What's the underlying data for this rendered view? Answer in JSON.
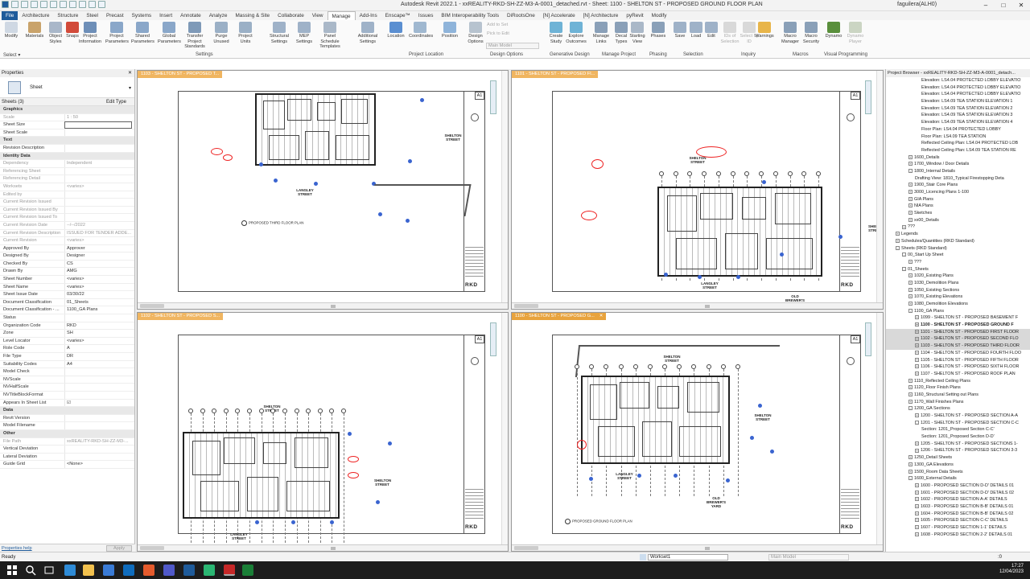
{
  "titlebar": {
    "title": "Autodesk Revit 2022.1 - xxREALITY-RKD-SH-ZZ-M3-A-0001_detached.rvt - Sheet: 1100 - SHELTON ST - PROPOSED GROUND FLOOR PLAN",
    "user": "faguilera(ALH0)"
  },
  "tabs": [
    "File",
    "Architecture",
    "Structure",
    "Steel",
    "Precast",
    "Systems",
    "Insert",
    "Annotate",
    "Analyze",
    "Massing & Site",
    "Collaborate",
    "View",
    "Manage",
    "Add-Ins",
    "Enscape™",
    "Issues",
    "BIM Interoperability Tools",
    "DiRootsOne",
    "[N] Accelerate",
    "[N] Architecture",
    "pyRevit",
    "Modify"
  ],
  "active_tab": "Manage",
  "ribbon": {
    "buttons": [
      "Modify",
      "Materials",
      "Object Styles",
      "Snaps",
      "Project Information",
      "Project Parameters",
      "Shared Parameters",
      "Global Parameters",
      "Transfer Project Standards",
      "Purge Unused",
      "Project Units",
      "Structural Settings",
      "MEP Settings",
      "Panel Schedule Templates",
      "Additional Settings",
      "Location",
      "Coordinates",
      "Position",
      "Design Options",
      "Create Study",
      "Explore Outcomes",
      "Manage Links",
      "Decal Types",
      "Starting View",
      "Phases",
      "Save",
      "Load",
      "Edit",
      "IDs of Selection",
      "Select by ID",
      "Warnings",
      "Macro Manager",
      "Macro Security",
      "Dynamo",
      "Dynamo Player"
    ],
    "small": [
      "Add to Set",
      "Pick to Edit"
    ],
    "design_option_value": "Main Model",
    "panels": [
      "Select ▾",
      "Settings",
      "Project Location",
      "Design Options",
      "Generative Design",
      "Manage Project",
      "Phasing",
      "Selection",
      "Inquiry",
      "Macros",
      "Visual Programming"
    ]
  },
  "properties": {
    "header": "Properties",
    "type_name": "Sheet",
    "filter": "Sheets (3)",
    "edit_type": "Edit Type",
    "rows": [
      {
        "g": "Graphics"
      },
      {
        "k": "Scale",
        "v": "1 : 50",
        "dis": true
      },
      {
        "k": "Sheet Size",
        "v": ""
      },
      {
        "k": "Sheet Scale",
        "v": ""
      },
      {
        "g": "Text"
      },
      {
        "k": "Revision Description",
        "v": ""
      },
      {
        "g": "Identity Data"
      },
      {
        "k": "Dependency",
        "v": "Independent",
        "dis": true
      },
      {
        "k": "Referencing Sheet",
        "v": "",
        "dis": true
      },
      {
        "k": "Referencing Detail",
        "v": "",
        "dis": true
      },
      {
        "k": "Worksets",
        "v": "<varies>",
        "dis": true
      },
      {
        "k": "Edited by",
        "v": "",
        "dis": true
      },
      {
        "k": "Current Revision Issued",
        "v": "",
        "dis": true
      },
      {
        "k": "Current Revision Issued By",
        "v": "",
        "dis": true
      },
      {
        "k": "Current Revision Issued To",
        "v": "",
        "dis": true
      },
      {
        "k": "Current Revision Date",
        "v": "--/--/2022",
        "dis": true
      },
      {
        "k": "Current Revision Description",
        "v": "ISSUED FOR TENDER ADDE...",
        "dis": true
      },
      {
        "k": "Current Revision",
        "v": "<varies>",
        "dis": true
      },
      {
        "k": "Approved By",
        "v": "Approver"
      },
      {
        "k": "Designed By",
        "v": "Designer"
      },
      {
        "k": "Checked By",
        "v": "CS"
      },
      {
        "k": "Drawn By",
        "v": "AMG"
      },
      {
        "k": "Sheet Number",
        "v": "<varies>"
      },
      {
        "k": "Sheet Name",
        "v": "<varies>"
      },
      {
        "k": "Sheet Issue Date",
        "v": "03/30/22"
      },
      {
        "k": "Document Classification",
        "v": "01_Sheets"
      },
      {
        "k": "Document Classification - ...",
        "v": "1100_GA Plans"
      },
      {
        "k": "Status",
        "v": ""
      },
      {
        "k": "Organization Code",
        "v": "RKD"
      },
      {
        "k": "Zone",
        "v": "SH"
      },
      {
        "k": "Level Locator",
        "v": "<varies>"
      },
      {
        "k": "Role Code",
        "v": "A"
      },
      {
        "k": "File Type",
        "v": "DR"
      },
      {
        "k": "Suitability Codes",
        "v": "A4"
      },
      {
        "k": "Model Check",
        "v": ""
      },
      {
        "k": "NVScale",
        "v": ""
      },
      {
        "k": "NVHalfScale",
        "v": ""
      },
      {
        "k": "NVTitleBlockFormat",
        "v": ""
      },
      {
        "k": "Appears In Sheet List",
        "v": "☑"
      },
      {
        "g": "Data"
      },
      {
        "k": "Revit Version",
        "v": ""
      },
      {
        "k": "Model Filename",
        "v": ""
      },
      {
        "g": "Other"
      },
      {
        "k": "File Path",
        "v": "xxREALITY-RKD-SH-ZZ-M3-...",
        "dis": true
      },
      {
        "k": "Vertical Deviation",
        "v": ""
      },
      {
        "k": "Lateral Deviation",
        "v": ""
      },
      {
        "k": "Guide Grid",
        "v": "<None>"
      }
    ],
    "help_link": "Properties help",
    "apply": "Apply"
  },
  "views": [
    {
      "tab": "1103 - SHELTON ST - PROPOSED T...",
      "active": false,
      "street": "LANGLEY STREET",
      "street2": "SHELTON STREET",
      "plan_title": "PROPOSED THIRD FLOOR PLAN"
    },
    {
      "tab": "1101 - SHELTON ST - PROPOSED FI...",
      "active": false,
      "street": "SHELTON STREET",
      "street2": "LANGLEY STREET",
      "street3": "OLD BREWER'S YARD",
      "plan_title": ""
    },
    {
      "tab": "1102 - SHELTON ST - PROPOSED S...",
      "active": false,
      "street": "SHELTON STREET",
      "street2": "LANGLEY STREET",
      "plan_title": ""
    },
    {
      "tab": "1100 - SHELTON ST - PROPOSED G...",
      "active": true,
      "street": "SHELTON STREET",
      "street2": "LANGLEY STREET",
      "street3": "OLD BREWER'S YARD",
      "plan_title": "PROPOSED GROUND FLOOR PLAN"
    }
  ],
  "sheet_labels": {
    "size": "A1",
    "logo": "RKD",
    "side_street": "SHELTON STREET"
  },
  "browser": {
    "header": "Project Browser - xxREALITY-RKD-SH-ZZ-M3-A-0001_detach...",
    "rows": [
      {
        "t": "Elevation: LS4.04 PROTECTED LOBBY ELEVATIO",
        "i": 5
      },
      {
        "t": "Elevation: LS4.04 PROTECTED LOBBY ELEVATIO",
        "i": 5
      },
      {
        "t": "Elevation: LS4.04 PROTECTED LOBBY ELEVATIO",
        "i": 5
      },
      {
        "t": "Elevation: LS4.09 TEA STATION ELEVATION 1",
        "i": 5
      },
      {
        "t": "Elevation: LS4.09 TEA STATION ELEVATION 2",
        "i": 5
      },
      {
        "t": "Elevation: LS4.09 TEA STATION ELEVATION 3",
        "i": 5
      },
      {
        "t": "Elevation: LS4.09 TEA STATION ELEVATION 4",
        "i": 5
      },
      {
        "t": "Floor Plan: LS4.04 PROTECTED LOBBY",
        "i": 5
      },
      {
        "t": "Floor Plan: LS4.09 TEA STATION",
        "i": 5
      },
      {
        "t": "Reflected Ceiling Plan: LS4.04 PROTECTED LOB",
        "i": 5
      },
      {
        "t": "Reflected Ceiling Plan: LS4.09 TEA STATION RE",
        "i": 5
      },
      {
        "t": "1600_Details",
        "i": 3,
        "tg": "+"
      },
      {
        "t": "1700_Window / Door Details",
        "i": 3,
        "tg": "+"
      },
      {
        "t": "1800_Internal Details",
        "i": 3,
        "tg": "-"
      },
      {
        "t": "Drafting View: 1810_Typical Firestopping Deta",
        "i": 4
      },
      {
        "t": "1900_Stair Core Plans",
        "i": 3,
        "tg": "+"
      },
      {
        "t": "3000_Licencing Plans 1-100",
        "i": 3,
        "tg": "+"
      },
      {
        "t": "GIA Plans",
        "i": 3,
        "tg": "+"
      },
      {
        "t": "NIA Plans",
        "i": 3,
        "tg": "+"
      },
      {
        "t": "Sketches",
        "i": 3,
        "tg": "+"
      },
      {
        "t": "xx00_Details",
        "i": 3,
        "tg": "+"
      },
      {
        "t": "???",
        "i": 2,
        "tg": "+"
      },
      {
        "t": "Legends",
        "i": 1,
        "tg": "+"
      },
      {
        "t": "Schedules/Quantities (RKD Standard)",
        "i": 1,
        "tg": "+"
      },
      {
        "t": "Sheets (RKD Standard)",
        "i": 1,
        "tg": "-"
      },
      {
        "t": "00_Start Up Sheet",
        "i": 2,
        "tg": "-"
      },
      {
        "t": "???",
        "i": 3,
        "tg": "+"
      },
      {
        "t": "01_Sheets",
        "i": 2,
        "tg": "-"
      },
      {
        "t": "1020_Existing Plans",
        "i": 3,
        "tg": "+"
      },
      {
        "t": "1030_Demolition Plans",
        "i": 3,
        "tg": "+"
      },
      {
        "t": "1050_Existing Sections",
        "i": 3,
        "tg": "+"
      },
      {
        "t": "1070_Existing Elevations",
        "i": 3,
        "tg": "+"
      },
      {
        "t": "1080_Demolition Elevations",
        "i": 3,
        "tg": "+"
      },
      {
        "t": "1100_GA Plans",
        "i": 3,
        "tg": "-"
      },
      {
        "t": "1099 - SHELTON ST - PROPOSED BASEMENT F",
        "i": 4,
        "tg": "+"
      },
      {
        "t": "1100 - SHELTON ST - PROPOSED GROUND F",
        "i": 4,
        "tg": "+",
        "bold": true
      },
      {
        "t": "1101 - SHELTON ST - PROPOSED FIRST FLOOR",
        "i": 4,
        "tg": "+",
        "sel": true
      },
      {
        "t": "1102 - SHELTON ST - PROPOSED SECOND FLO",
        "i": 4,
        "tg": "+",
        "sel": true
      },
      {
        "t": "1103 - SHELTON ST - PROPOSED THIRD FLOOR",
        "i": 4,
        "tg": "+",
        "sel": true
      },
      {
        "t": "1104 - SHELTON ST - PROPOSED FOURTH FLOO",
        "i": 4,
        "tg": "+"
      },
      {
        "t": "1105 - SHELTON ST - PROPOSED FIFTH FLOOR",
        "i": 4,
        "tg": "+"
      },
      {
        "t": "1106 - SHELTON ST - PROPOSED SIXTH FLOOR",
        "i": 4,
        "tg": "+"
      },
      {
        "t": "1107 - SHELTON ST - PROPOSED ROOF PLAN",
        "i": 4,
        "tg": "+"
      },
      {
        "t": "1110_Reflected Ceiling Plans",
        "i": 3,
        "tg": "+"
      },
      {
        "t": "1120_Floor Finish Plans",
        "i": 3,
        "tg": "+"
      },
      {
        "t": "1160_Structural Setting out Plans",
        "i": 3,
        "tg": "+"
      },
      {
        "t": "1170_Wall Finishes Plans",
        "i": 3,
        "tg": "+"
      },
      {
        "t": "1200_GA Sections",
        "i": 3,
        "tg": "-"
      },
      {
        "t": "1200 - SHELTON ST - PROPOSED SECTION A-A",
        "i": 4,
        "tg": "+"
      },
      {
        "t": "1201 - SHELTON ST - PROPOSED SECTION C-C",
        "i": 4,
        "tg": "-"
      },
      {
        "t": "Section: 1201_Proposed Section C-C'",
        "i": 5
      },
      {
        "t": "Section: 1201_Proposed Section D-D'",
        "i": 5
      },
      {
        "t": "1205 - SHELTON ST - PROPOSED SECTIONS 1-",
        "i": 4,
        "tg": "+"
      },
      {
        "t": "1206 - SHELTON ST - PROPOSED SECTION 3-3",
        "i": 4,
        "tg": "+"
      },
      {
        "t": "1250_Detail Sheets",
        "i": 3,
        "tg": "+"
      },
      {
        "t": "1300_GA Elevations",
        "i": 3,
        "tg": "+"
      },
      {
        "t": "1500_Room Data Sheets",
        "i": 3,
        "tg": "+"
      },
      {
        "t": "1600_External Details",
        "i": 3,
        "tg": "-"
      },
      {
        "t": "1600 - PROPOSED SECTION D-D' DETAILS 01",
        "i": 4,
        "tg": "+"
      },
      {
        "t": "1601 - PROPOSED SECTION D-D' DETAILS 02",
        "i": 4,
        "tg": "+"
      },
      {
        "t": "1602 - PROPOSED SECTION A-A' DETAILS",
        "i": 4,
        "tg": "+"
      },
      {
        "t": "1603 - PROPOSED SECTION B-B' DETAILS 01",
        "i": 4,
        "tg": "+"
      },
      {
        "t": "1604 - PROPOSED SECTION B-B' DETAILS 02",
        "i": 4,
        "tg": "+"
      },
      {
        "t": "1605 - PROPOSED SECTION C-C' DETAILS",
        "i": 4,
        "tg": "+"
      },
      {
        "t": "1607 - PROPOSED SECTION 1-1' DETAILS",
        "i": 4,
        "tg": "+"
      },
      {
        "t": "1608 - PROPOSED SECTION 2-2' DETAILS 01",
        "i": 4,
        "tg": "+"
      }
    ]
  },
  "status": {
    "left": "Ready",
    "workset": "Workset1",
    "model": "Main Model",
    "zero": ":0"
  },
  "taskbar": {
    "time": "17:27",
    "date": "12/04/2023"
  },
  "colors": {
    "accent": "#1f5b9a",
    "active_tab": "#e8a33d",
    "cloud": "#e22222",
    "tag": "#3a64d0"
  }
}
